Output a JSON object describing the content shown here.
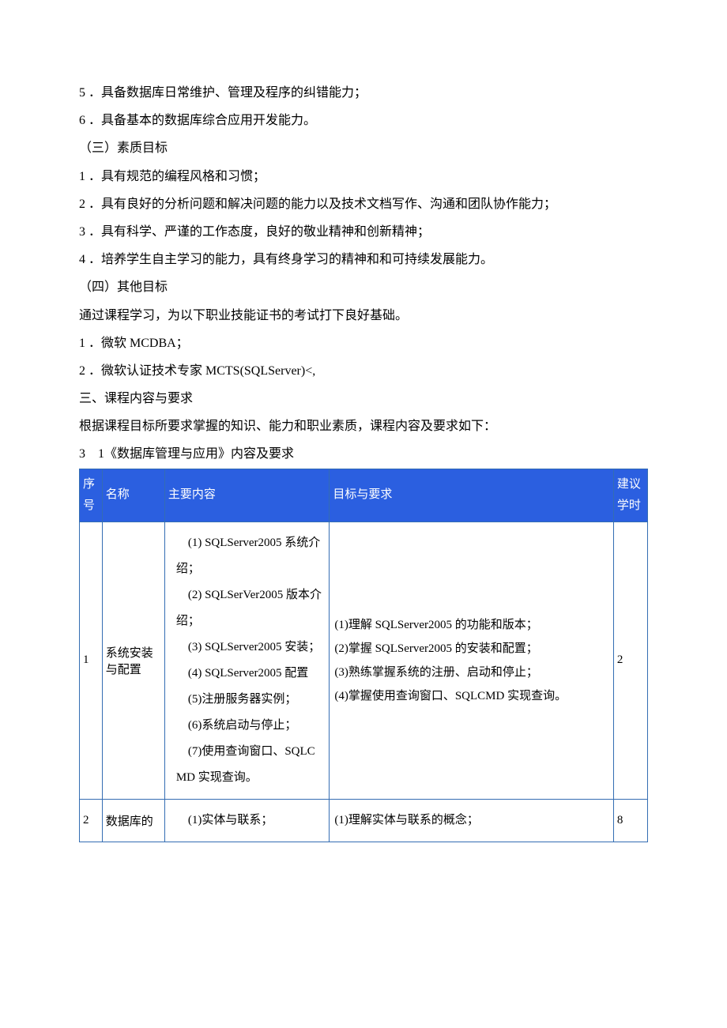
{
  "lines": {
    "l1": "5 ．具备数据库日常维护、管理及程序的纠错能力；",
    "l2": "6 ．具备基本的数据库综合应用开发能力。",
    "l3": "（三）素质目标",
    "l4": "1 ．具有规范的编程风格和习惯；",
    "l5": "2 ．具有良好的分析问题和解决问题的能力以及技术文档写作、沟通和团队协作能力；",
    "l6": "3 ．具有科学、严谨的工作态度，良好的敬业精神和创新精神；",
    "l7": "4 ．培养学生自主学习的能力，具有终身学习的精神和和可持续发展能力。",
    "l8": "（四）其他目标",
    "l9": "通过课程学习，为以下职业技能证书的考试打下良好基础。",
    "l10": "1 ．微软 MCDBA；",
    "l11": "2 ．微软认证技术专家 MCTS(SQLServer)<,",
    "l12": "三、课程内容与要求",
    "l13": "根据课程目标所要求掌握的知识、能力和职业素质，课程内容及要求如下：",
    "l14": "3　1《数据库管理与应用》内容及要求"
  },
  "table": {
    "headers": {
      "seq": "序号",
      "name": "名称",
      "main": "主要内容",
      "goal": "目标与要求",
      "hours": "建议学时"
    },
    "rows": [
      {
        "seq": "1",
        "name": "系统安装与配置",
        "main": "　(1) SQLServer2005 系统介绍；\n　(2) SQLSerVer2005 版本介绍；\n　(3) SQLServer2005 安装；\n　(4) SQLServer2005 配置\n　(5)注册服务器实例；\n　(6)系统启动与停止；\n　(7)使用查询窗口、SQLCMD 实现查询。",
        "goal": "(1)理解 SQLServer2005 的功能和版本；\n(2)掌握 SQLServer2005 的安装和配置；\n(3)熟练掌握系统的注册、启动和停止；\n(4)掌握使用查询窗口、SQLCMD 实现查询。",
        "hours": "2"
      },
      {
        "seq": "2",
        "name": "数据库的",
        "main": "　(1)实体与联系；",
        "goal": "(1)理解实体与联系的概念；",
        "hours": "8"
      }
    ]
  }
}
